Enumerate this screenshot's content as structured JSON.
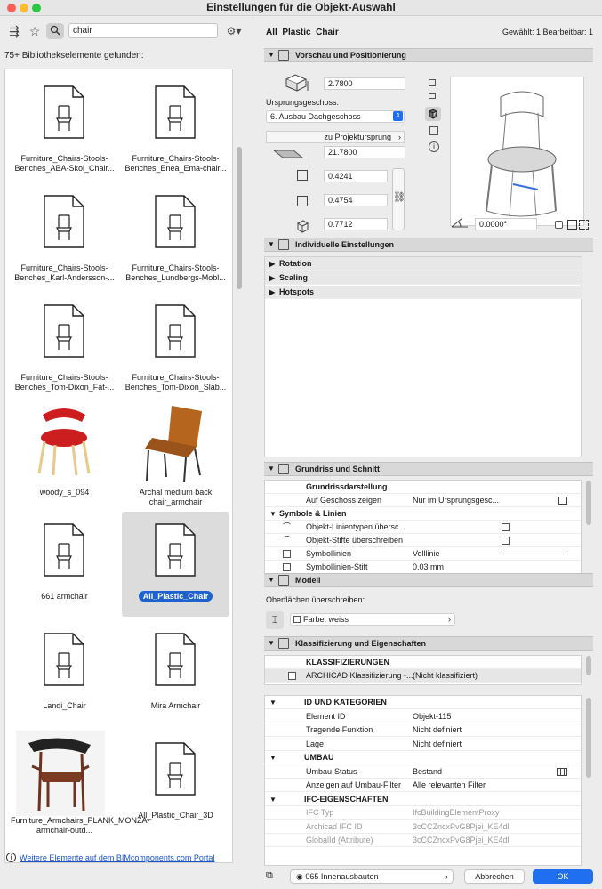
{
  "window": {
    "title": "Einstellungen für die Objekt-Auswahl"
  },
  "left": {
    "search_value": "chair",
    "found_text": "75+ Bibliothekselemente gefunden:",
    "items": [
      {
        "label": "Furniture_Chairs-Stools-Benches_ABA-Skol_Chair...",
        "kind": "doc"
      },
      {
        "label": "Furniture_Chairs-Stools-Benches_Enea_Ema-chair...",
        "kind": "doc"
      },
      {
        "label": "Furniture_Chairs-Stools-Benches_Karl-Andersson-...",
        "kind": "doc"
      },
      {
        "label": "Furniture_Chairs-Stools-Benches_Lundbergs-Mobl...",
        "kind": "doc"
      },
      {
        "label": "Furniture_Chairs-Stools-Benches_Tom-Dixon_Fat-...",
        "kind": "doc"
      },
      {
        "label": "Furniture_Chairs-Stools-Benches_Tom-Dixon_Slab...",
        "kind": "doc"
      },
      {
        "label": "woody_s_094",
        "kind": "photo-red"
      },
      {
        "label": "Archal medium back chair_armchair",
        "kind": "photo-wood"
      },
      {
        "label": "661 armchair",
        "kind": "doc"
      },
      {
        "label": "All_Plastic_Chair",
        "kind": "doc",
        "selected": true
      },
      {
        "label": "Landi_Chair",
        "kind": "doc"
      },
      {
        "label": "Mira Armchair",
        "kind": "doc"
      },
      {
        "label": "Furniture_Armchairs_PLANK_MONZA-armchair-outd...",
        "kind": "photo-monza"
      },
      {
        "label": "All_Plastic_Chair_3D",
        "kind": "doc"
      }
    ],
    "footer_link": "Weitere Elemente auf dem BIMcomponents.com Portal"
  },
  "right": {
    "object_name": "All_Plastic_Chair",
    "selection_info": "Gewählt: 1 Bearbeitbar: 1",
    "sections": {
      "preview": "Vorschau und Positionierung",
      "custom": "Individuelle Einstellungen",
      "floorplan": "Grundriss und Schnitt",
      "model": "Modell",
      "classification": "Klassifizierung und Eigenschaften"
    },
    "positioning": {
      "height_value": "2.7800",
      "home_story_label": "Ursprungsgeschoss:",
      "home_story_value": "6. Ausbau Dachgeschoss",
      "project_origin_label": "zu Projektursprung",
      "elevation_value": "21.7800",
      "x_value": "0.4241",
      "y_value": "0.4754",
      "z_value": "0.7712",
      "angle_value": "0.0000°"
    },
    "custom_items": [
      "Rotation",
      "Scaling",
      "Hotspots"
    ],
    "floorplan_rows": [
      {
        "type": "header",
        "c1": "Grundrissdarstellung"
      },
      {
        "type": "row",
        "c1": "Auf Geschoss zeigen",
        "c2": "Nur im Ursprungsgesc..."
      },
      {
        "type": "group",
        "c1": "Symbole & Linien"
      },
      {
        "type": "row",
        "c1": "Objekt-Linientypen übersc...",
        "c2": ""
      },
      {
        "type": "row",
        "c1": "Objekt-Stifte überschreiben",
        "c2": ""
      },
      {
        "type": "row",
        "c1": "Symbollinien",
        "c2": "Volllinie"
      },
      {
        "type": "row",
        "c1": "Symbollinien-Stift",
        "c2": "0.03 mm"
      }
    ],
    "model": {
      "surfaces_label": "Oberflächen überschreiben:",
      "surface_value": "Farbe, weiss"
    },
    "classification": {
      "header": "KLASSIFIZIERUNGEN",
      "row_label": "ARCHICAD Klassifizierung -...",
      "row_value": "(Nicht klassifiziert)"
    },
    "properties": [
      {
        "type": "group",
        "c1": "ID UND KATEGORIEN"
      },
      {
        "type": "row",
        "c1": "Element ID",
        "c2": "Objekt-115"
      },
      {
        "type": "row",
        "c1": "Tragende Funktion",
        "c2": "Nicht definiert"
      },
      {
        "type": "row",
        "c1": "Lage",
        "c2": "Nicht definiert"
      },
      {
        "type": "group",
        "c1": "UMBAU"
      },
      {
        "type": "row",
        "c1": "Umbau-Status",
        "c2": "Bestand"
      },
      {
        "type": "row",
        "c1": "Anzeigen auf Umbau-Filter",
        "c2": "Alle relevanten Filter"
      },
      {
        "type": "group",
        "c1": "IFC-EIGENSCHAFTEN"
      },
      {
        "type": "gray",
        "c1": "IFC Typ",
        "c2": "IfcBuildingElementProxy"
      },
      {
        "type": "gray",
        "c1": "Archicad IFC ID",
        "c2": "3cCCZncxPvG8Pjei_KE4dl"
      },
      {
        "type": "gray",
        "c1": "GlobalId (Attribute)",
        "c2": "3cCCZncxPvG8Pjei_KE4dl"
      }
    ],
    "bottom": {
      "layer_value": "065 Innenausbauten",
      "cancel_label": "Abbrechen",
      "ok_label": "OK"
    }
  },
  "colors": {
    "accent": "#1f6ff0",
    "chair_red": "#cc1e1e",
    "chair_wood": "#b5651d"
  }
}
